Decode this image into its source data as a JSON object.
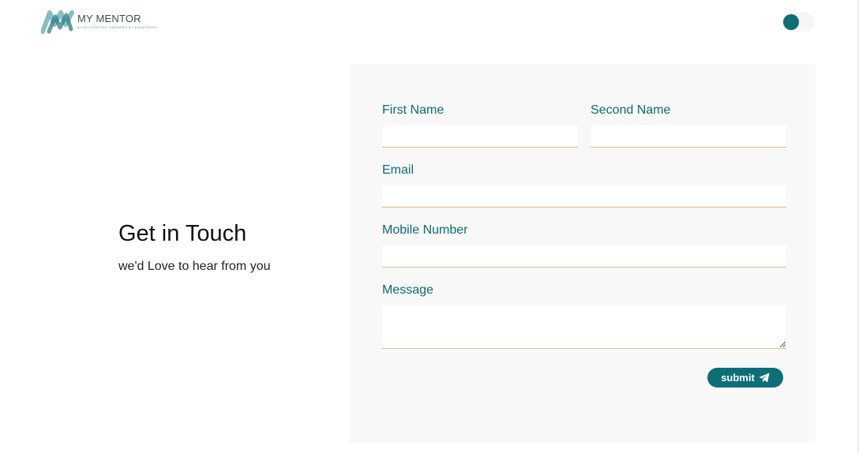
{
  "header": {
    "logo_title": "MY MENTOR",
    "logo_tagline": "ACCELERATING CAREERS & LEADERSHIP",
    "logo_icon": "mm-brush-logo",
    "theme_toggle_icon": "toggle-switch-icon"
  },
  "intro": {
    "heading": "Get in Touch",
    "subheading": "we'd Love to hear from you"
  },
  "form": {
    "first_name_label": "First Name",
    "first_name_value": "",
    "second_name_label": "Second Name",
    "second_name_value": "",
    "email_label": "Email",
    "email_value": "",
    "mobile_label": "Mobile Number",
    "mobile_value": "",
    "message_label": "Message",
    "message_value": "",
    "submit_label": "submit",
    "submit_icon": "paper-plane-icon"
  },
  "colors": {
    "accent": "#0d6e76",
    "label": "#0e6a73",
    "input_underline": "#e2b887",
    "panel_background": "#f8f8f8"
  }
}
